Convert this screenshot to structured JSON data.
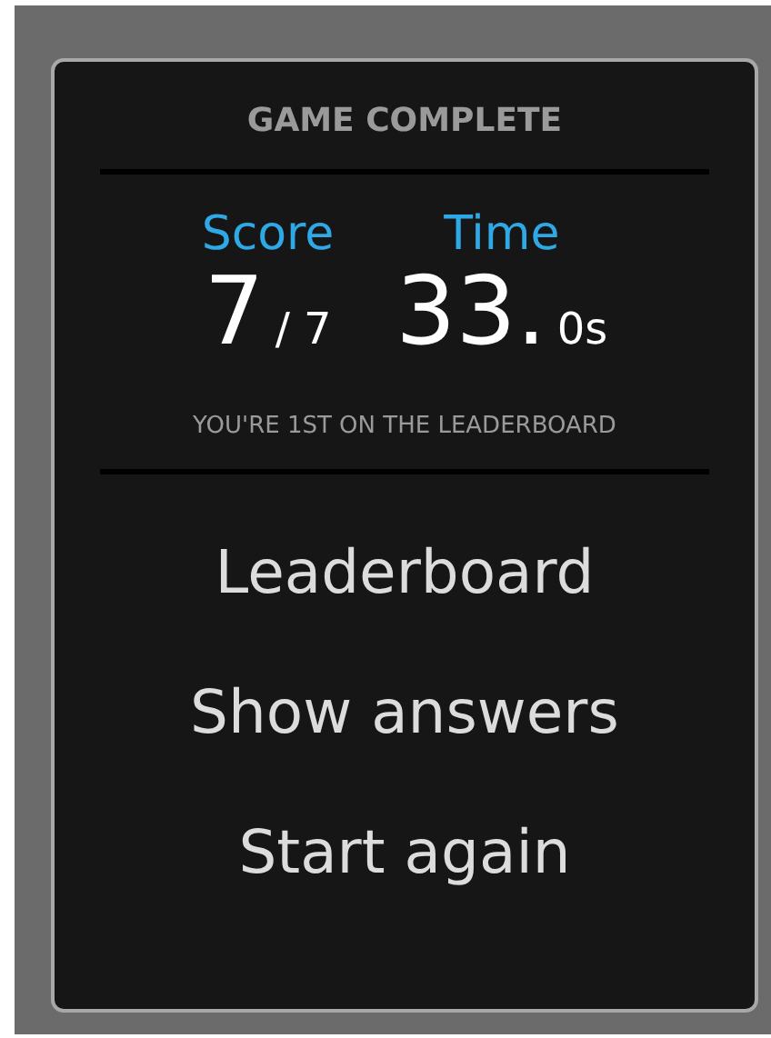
{
  "title": "GAME COMPLETE",
  "stats": [
    {
      "label": "Score",
      "value": "7",
      "suffix": "/ 7"
    },
    {
      "label": "Time",
      "value": "33.",
      "suffix": "0s"
    }
  ],
  "message": "YOU'RE 1ST ON THE LEADERBOARD",
  "buttons": [
    "Leaderboard",
    "Show answers",
    "Start again"
  ]
}
